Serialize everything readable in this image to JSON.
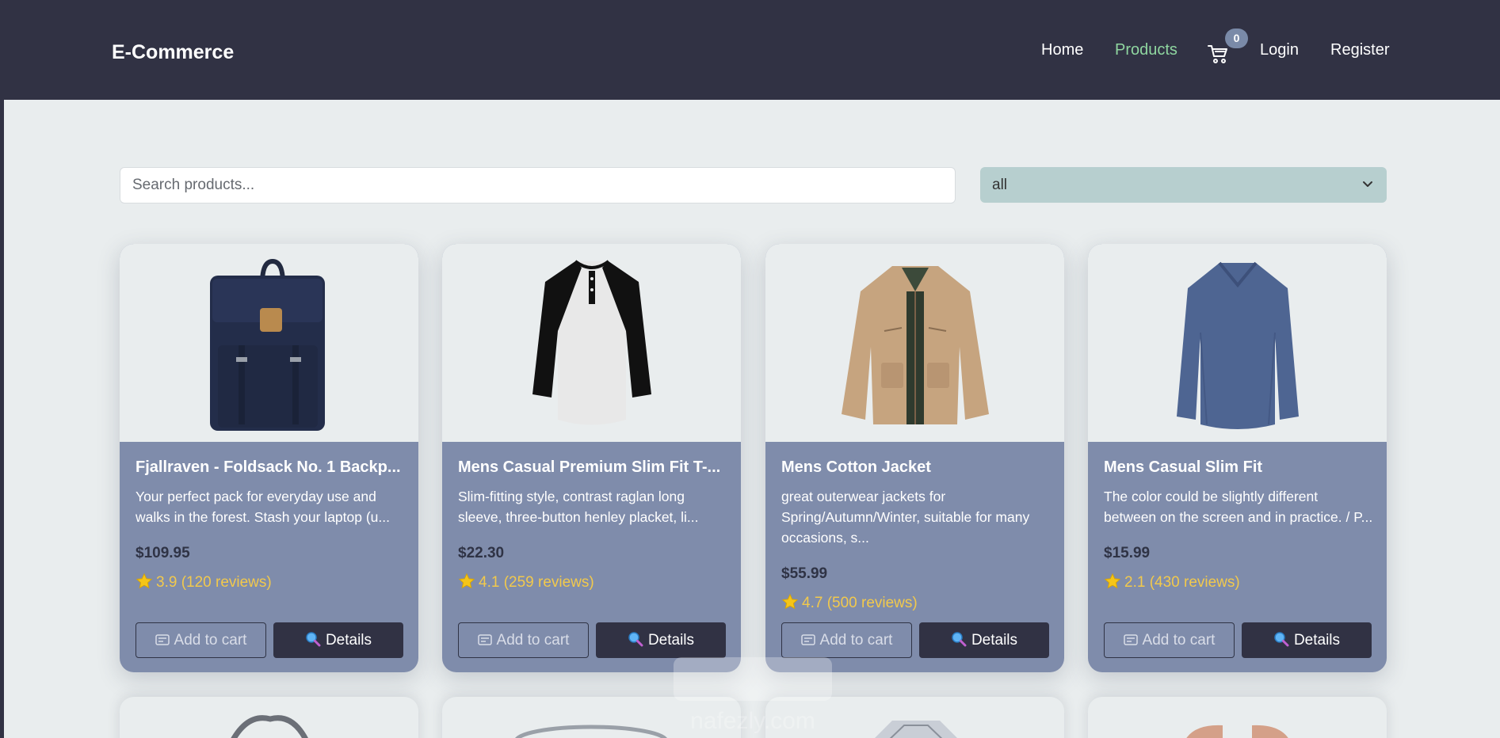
{
  "navbar": {
    "brand": "E-Commerce",
    "links": [
      {
        "label": "Home"
      },
      {
        "label": "Products",
        "active": true
      },
      {
        "label": "Login"
      },
      {
        "label": "Register"
      }
    ],
    "cart_count": "0",
    "cart_icon": "shopping-cart-icon",
    "active_color": "#8fd6a0"
  },
  "search": {
    "placeholder": "Search products...",
    "value": ""
  },
  "category_filter": {
    "selected": "all",
    "icon": "chevron-down-icon"
  },
  "products": [
    {
      "title": "Fjallraven - Foldsack No. 1 Backp...",
      "description": "Your perfect pack for everyday use and walks in the forest. Stash your laptop (u...",
      "price": "$109.95",
      "rating": "3.9 (120 reviews)",
      "add_to_cart_label": "Add to cart",
      "details_label": "Details"
    },
    {
      "title": "Mens Casual Premium Slim Fit T-...",
      "description": "Slim-fitting style, contrast raglan long sleeve, three-button henley placket, li...",
      "price": "$22.30",
      "rating": "4.1 (259 reviews)",
      "add_to_cart_label": "Add to cart",
      "details_label": "Details"
    },
    {
      "title": "Mens Cotton Jacket",
      "description": "great outerwear jackets for Spring/Autumn/Winter, suitable for many occasions, s...",
      "price": "$55.99",
      "rating": "4.7 (500 reviews)",
      "add_to_cart_label": "Add to cart",
      "details_label": "Details"
    },
    {
      "title": "Mens Casual Slim Fit",
      "description": "The color could be slightly different between on the screen and in practice. / P...",
      "price": "$15.99",
      "rating": "2.1 (430 reviews)",
      "add_to_cart_label": "Add to cart",
      "details_label": "Details"
    }
  ],
  "watermark": {
    "text": "nafezly.com"
  },
  "colors": {
    "navbar_bg": "#313244",
    "page_bg": "#e9edee",
    "card_body": "#7f8cab",
    "select_bg": "#b7cfcf",
    "rating": "#f2c94c",
    "details_button": "#313244"
  }
}
